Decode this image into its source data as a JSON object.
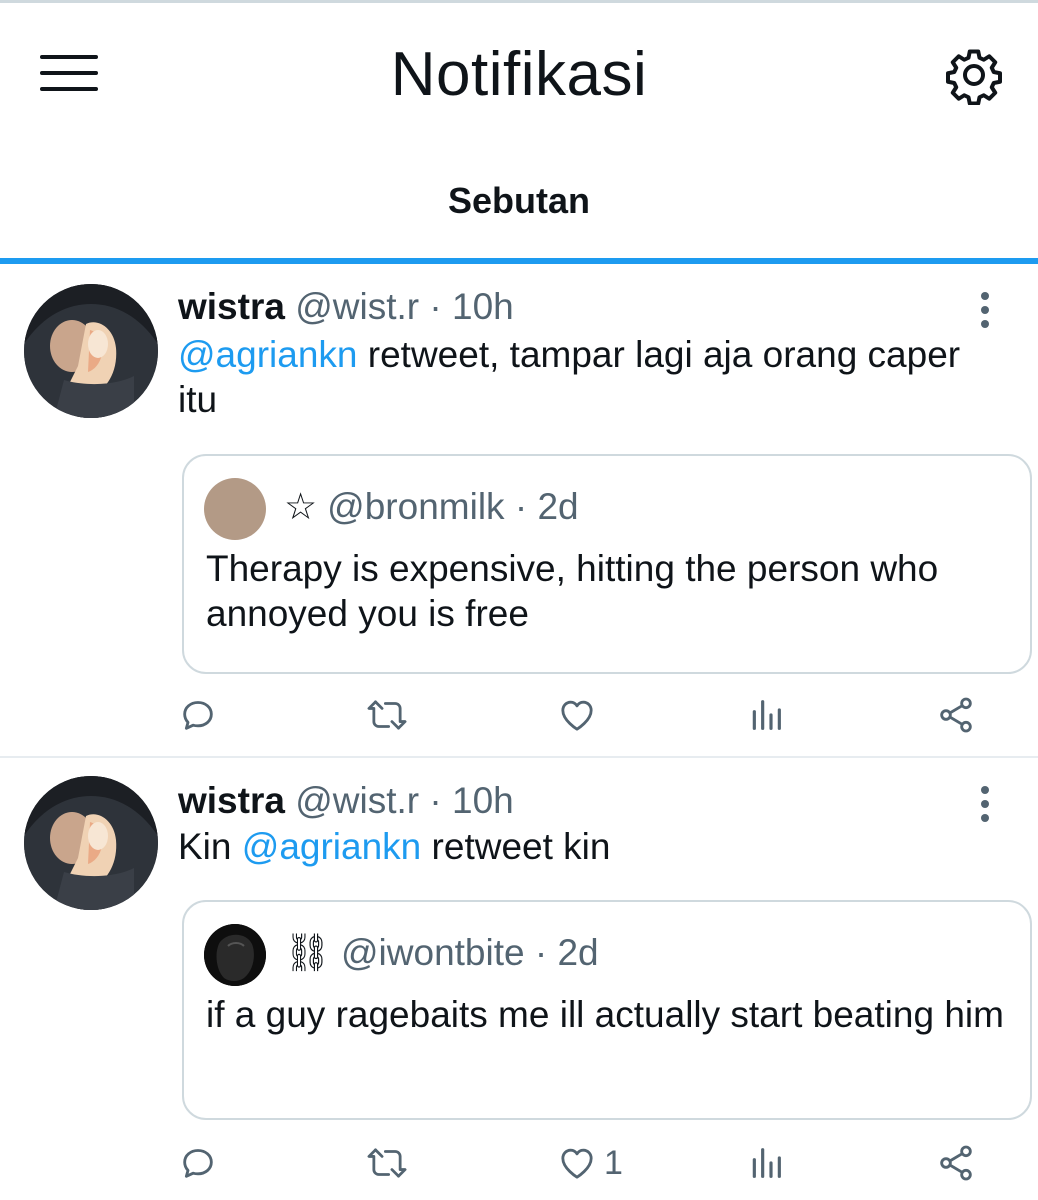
{
  "header": {
    "title": "Notifikasi",
    "menu_icon": "menu-icon",
    "settings_icon": "gear-icon"
  },
  "tabs": [
    {
      "label": "Sebutan",
      "active": true
    }
  ],
  "colors": {
    "accent": "#1d9bf0",
    "text": "#0f1419",
    "muted": "#536471",
    "border": "#cfd9de"
  },
  "tweets": [
    {
      "name": "wistra",
      "handle": "@wist.r",
      "separator": "·",
      "time": "10h",
      "text_prefix": "",
      "mention": "@agriankn",
      "text_suffix": " retweet, tampar lagi aja orang caper itu",
      "quote": {
        "badge": "☆",
        "handle": "@bronmilk",
        "separator": "·",
        "time": "2d",
        "text": "Therapy is expensive, hitting the person who annoyed you is free"
      },
      "actions": {
        "reply_icon": "reply-icon",
        "retweet_icon": "retweet-icon",
        "like_icon": "heart-icon",
        "like_count": "",
        "views_icon": "analytics-icon",
        "share_icon": "share-icon"
      }
    },
    {
      "name": "wistra",
      "handle": "@wist.r",
      "separator": "·",
      "time": "10h",
      "text_prefix": "Kin ",
      "mention": "@agriankn",
      "text_suffix": " retweet kin",
      "quote": {
        "badge": "⛓",
        "handle": "@iwontbite",
        "separator": "·",
        "time": "2d",
        "text": "if a guy ragebaits me ill actually start beating him"
      },
      "actions": {
        "reply_icon": "reply-icon",
        "retweet_icon": "retweet-icon",
        "like_icon": "heart-icon",
        "like_count": "1",
        "views_icon": "analytics-icon",
        "share_icon": "share-icon"
      }
    }
  ]
}
